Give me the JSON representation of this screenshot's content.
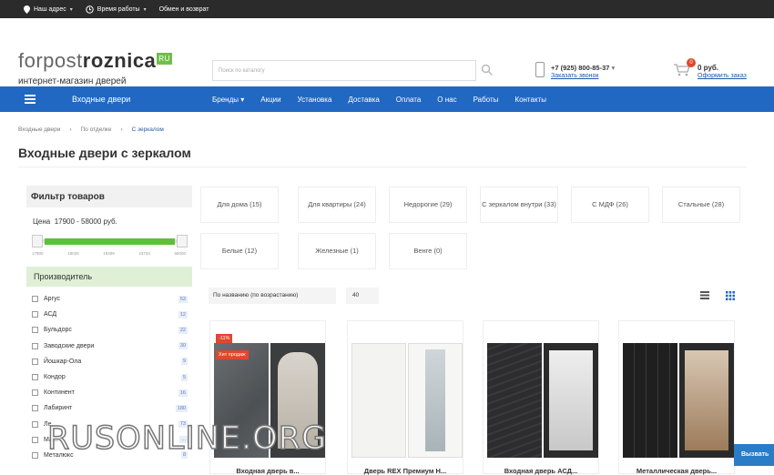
{
  "topbar": {
    "address": "Наш адрес",
    "hours": "Время работы",
    "returns": "Обмен и возврат"
  },
  "logo": {
    "part1": "forpost",
    "part2": "roznica",
    "ru": "RU",
    "tagline": "интернет-магазин дверей"
  },
  "search": {
    "placeholder": "Поиск по каталогу"
  },
  "contact": {
    "phone": "+7 (925) 800-85-37",
    "callback": "Заказать звонок"
  },
  "cart": {
    "count": "0",
    "sum": "0 руб.",
    "link": "Оформить заказ"
  },
  "nav": {
    "catalog": "Входные двери",
    "links": [
      "Бренды",
      "Акции",
      "Установка",
      "Доставка",
      "Оплата",
      "О нас",
      "Работы",
      "Контакты"
    ]
  },
  "breadcrumbs": [
    "Входные двери",
    "По отделке",
    "С зеркалом"
  ],
  "title": "Входные двери с зеркалом",
  "filter": {
    "title": "Фильтр товаров",
    "price_label": "Цена",
    "price_range": "17900 - 58000 руб.",
    "price_min": 17900,
    "price_max": 58000,
    "ticks": [
      "17900",
      "18025",
      "19309",
      "23733",
      "58000"
    ],
    "manufacturer_title": "Производитель",
    "manufacturers": [
      {
        "name": "Аргус",
        "count": "53"
      },
      {
        "name": "АСД",
        "count": "12"
      },
      {
        "name": "Бульдорс",
        "count": "22"
      },
      {
        "name": "Заводские двери",
        "count": "30"
      },
      {
        "name": "Йошкар-Ола",
        "count": "9"
      },
      {
        "name": "Кондор",
        "count": "5"
      },
      {
        "name": "Континент",
        "count": "16"
      },
      {
        "name": "Лабиринт",
        "count": "180"
      },
      {
        "name": "Ле...",
        "count": "73"
      },
      {
        "name": "Ма...",
        "count": "..."
      },
      {
        "name": "Металюкс",
        "count": "8"
      }
    ]
  },
  "tags": [
    "Для дома (15)",
    "Для квартиры (24)",
    "Недорогие (29)",
    "С зеркалом внутри (33)",
    "С МДФ (26)",
    "Стальные (28)",
    "Белые (12)",
    "Железные (1)",
    "Венге (0)"
  ],
  "toolbar": {
    "sort": "По названию (по возрастанию)",
    "per_page": "40"
  },
  "products": [
    {
      "name": "Входная дверь в...",
      "badges": [
        "-11%",
        "Хит продаж"
      ]
    },
    {
      "name": "Дверь REX Премиум Н...",
      "badges": []
    },
    {
      "name": "Входная дверь АСД...",
      "badges": []
    },
    {
      "name": "Металлическая дверь...",
      "badges": []
    }
  ],
  "watermark": "RUSONLINE.ORG",
  "chat": "Вызвать"
}
